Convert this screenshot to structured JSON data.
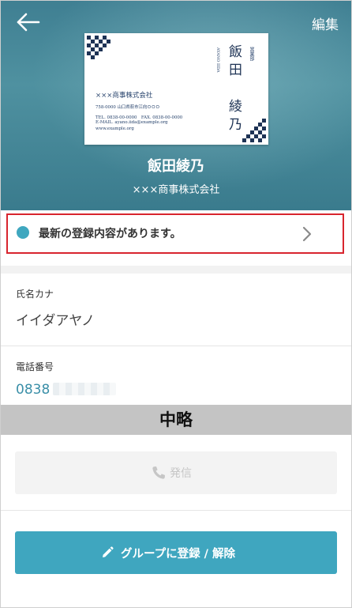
{
  "header": {
    "edit_label": "編集",
    "person_name": "飯田綾乃",
    "person_company": "×××商事株式会社"
  },
  "business_card": {
    "company": "×××商事株式会社",
    "address": "758-0000 山口県萩市江向ＯＯＯ",
    "tel_fax": "TEL. 0838-00-0000　FAX. 0838-00-0000",
    "email": "E-MAIL. ayano.iida@example.org",
    "url": "www.example.org",
    "name_vertical": "飯田　綾乃",
    "department": "営業部",
    "name_roman": "AYANO IIDA",
    "accent_color": "#1e3355"
  },
  "update_banner": {
    "text": "最新の登録内容があります。",
    "dot_color": "#3fa7bf",
    "highlight_color": "#d8252e"
  },
  "fields": {
    "kana_label": "氏名カナ",
    "kana_value": "イイダアヤノ",
    "phone_label": "電話番号",
    "phone_value": "0838"
  },
  "omitted_label": "中略",
  "actions": {
    "call_label": "発信",
    "group_label": "グループに登録 / 解除",
    "primary_color": "#3fa6bf"
  }
}
